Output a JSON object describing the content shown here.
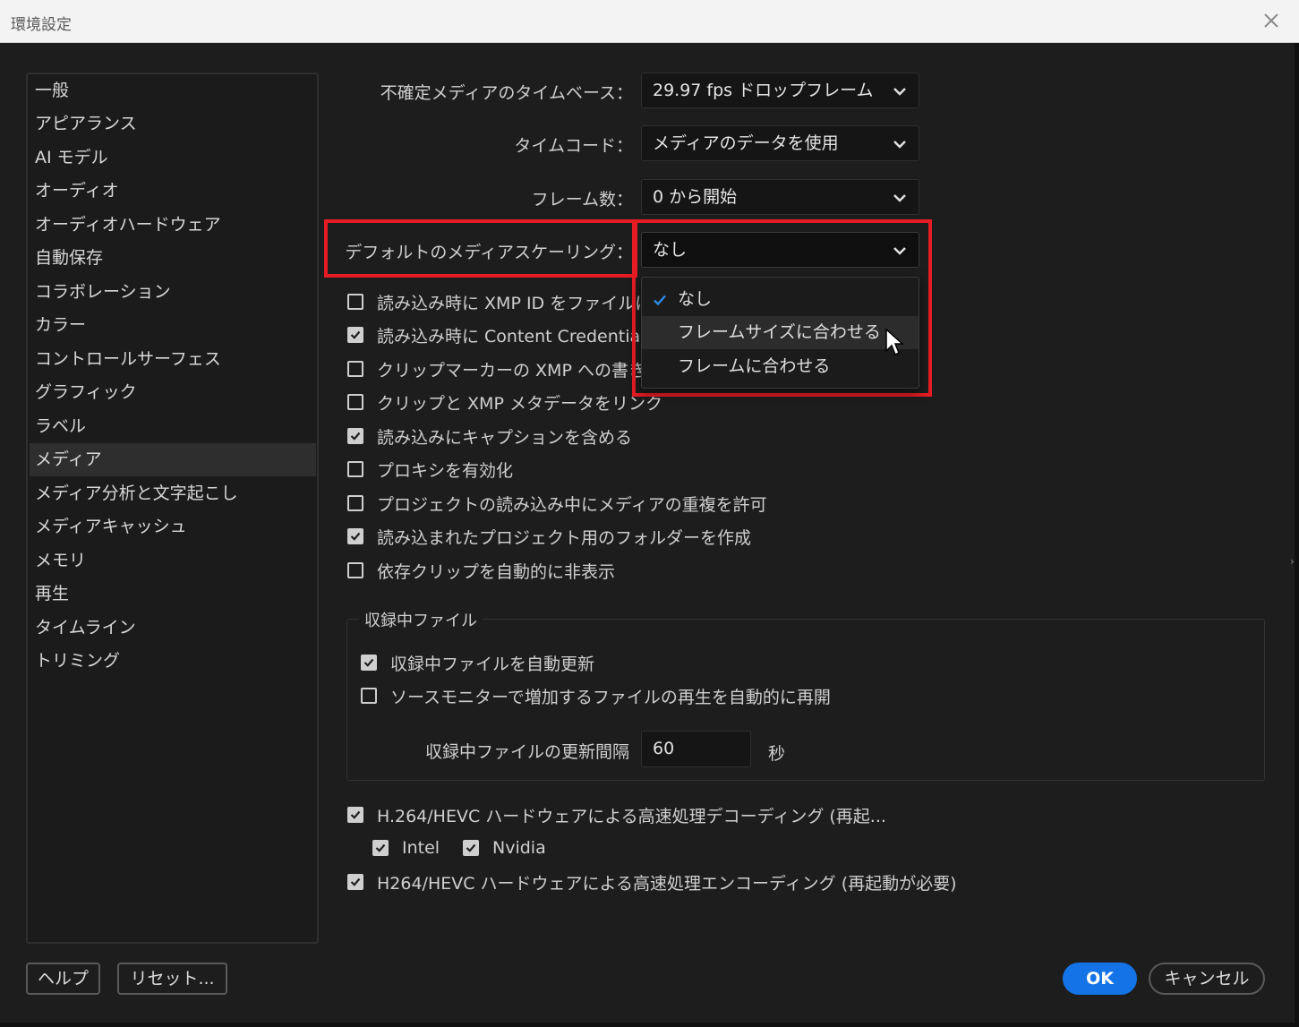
{
  "window": {
    "title": "環境設定",
    "close_icon": "close-icon"
  },
  "sidebar": {
    "items": [
      {
        "label": "一般"
      },
      {
        "label": "アピアランス"
      },
      {
        "label": "AI モデル"
      },
      {
        "label": "オーディオ"
      },
      {
        "label": "オーディオハードウェア"
      },
      {
        "label": "自動保存"
      },
      {
        "label": "コラボレーション"
      },
      {
        "label": "カラー"
      },
      {
        "label": "コントロールサーフェス"
      },
      {
        "label": "グラフィック"
      },
      {
        "label": "ラベル"
      },
      {
        "label": "メディア",
        "active": true
      },
      {
        "label": "メディア分析と文字起こし"
      },
      {
        "label": "メディアキャッシュ"
      },
      {
        "label": "メモリ"
      },
      {
        "label": "再生"
      },
      {
        "label": "タイムライン"
      },
      {
        "label": "トリミング"
      }
    ]
  },
  "form": {
    "timebase": {
      "label": "不確定メディアのタイムベース：",
      "value": "29.97 fps ドロップフレーム"
    },
    "timecode": {
      "label": "タイムコード：",
      "value": "メディアのデータを使用"
    },
    "frame_count": {
      "label": "フレーム数：",
      "value": "0 から開始"
    },
    "scaling": {
      "label": "デフォルトのメディアスケーリング：",
      "value": "なし"
    }
  },
  "dropdown": {
    "options": [
      {
        "label": "なし",
        "selected": true
      },
      {
        "label": "フレームサイズに合わせる",
        "hover": true
      },
      {
        "label": "フレームに合わせる"
      }
    ]
  },
  "checkboxes": [
    {
      "label": "読み込み時に XMP ID をファイルに",
      "checked": false
    },
    {
      "label": "読み込み時に Content Credentials",
      "checked": true
    },
    {
      "label": "クリップマーカーの XMP への書き",
      "checked": false
    },
    {
      "label": "クリップと XMP メタデータをリンク",
      "checked": false
    },
    {
      "label": "読み込みにキャプションを含める",
      "checked": true
    },
    {
      "label": "プロキシを有効化",
      "checked": false
    },
    {
      "label": "プロジェクトの読み込み中にメディアの重複を許可",
      "checked": false
    },
    {
      "label": "読み込まれたプロジェクト用のフォルダーを作成",
      "checked": true
    },
    {
      "label": "依存クリップを自動的に非表示",
      "checked": false
    }
  ],
  "growing_files": {
    "title": "収録中ファイル",
    "auto_refresh": {
      "label": "収録中ファイルを自動更新",
      "checked": true
    },
    "auto_resume": {
      "label": "ソースモニターで増加するファイルの再生を自動的に再開",
      "checked": false
    },
    "interval_label": "収録中ファイルの更新間隔",
    "interval_value": "60",
    "interval_unit": "秒"
  },
  "hardware": {
    "decode": {
      "label": "H.264/HEVC ハードウェアによる高速処理デコーディング (再起...",
      "checked": true
    },
    "intel": {
      "label": "Intel",
      "checked": true
    },
    "nvidia": {
      "label": "Nvidia",
      "checked": true
    },
    "encode": {
      "label": "H264/HEVC ハードウェアによる高速処理エンコーディング (再起動が必要)",
      "checked": true
    }
  },
  "footer": {
    "help": "ヘルプ",
    "reset": "リセット...",
    "ok": "OK",
    "cancel": "キャンセル"
  },
  "colors": {
    "accent": "#1473e6",
    "highlight_box": "#e51c23"
  }
}
